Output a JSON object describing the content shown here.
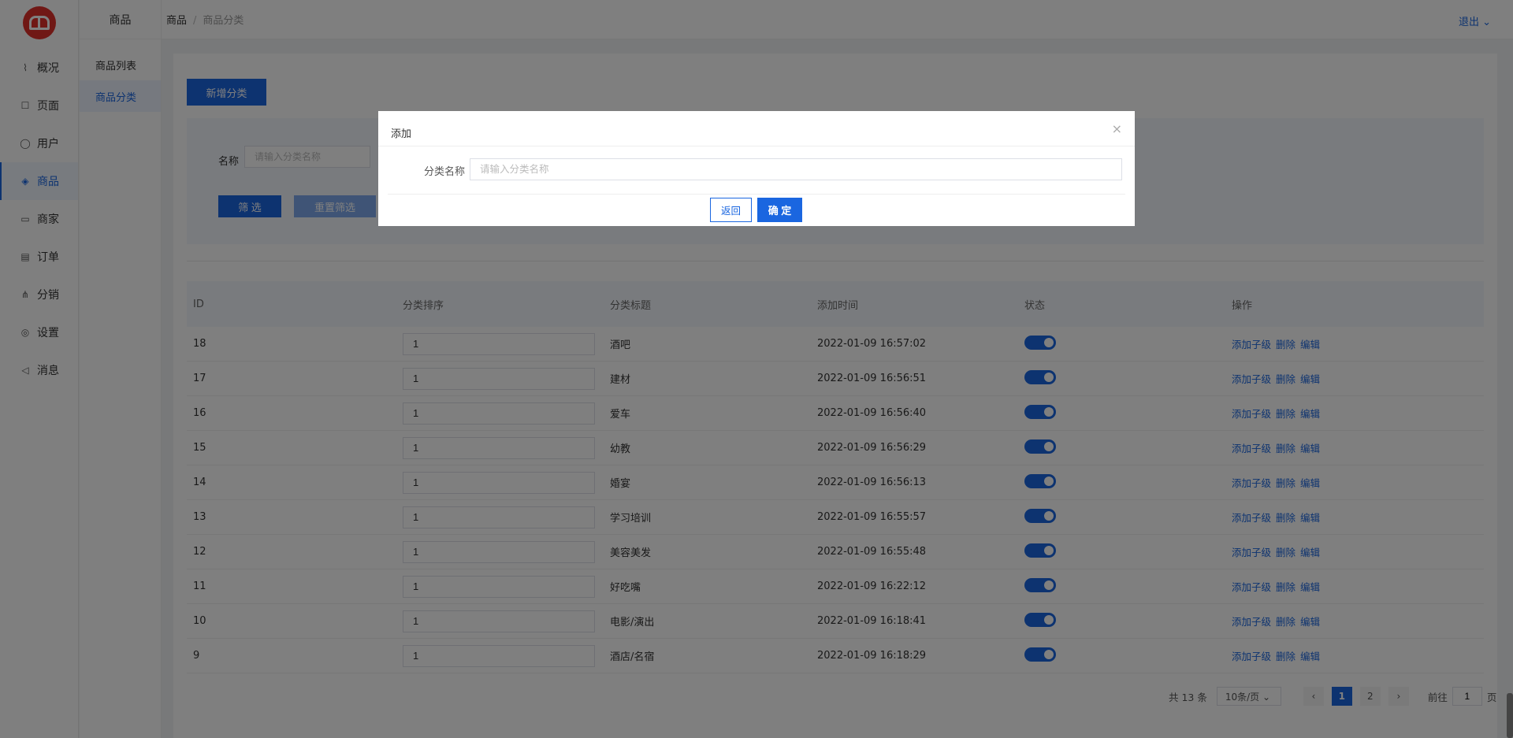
{
  "sidebar": {
    "items": [
      {
        "label": "概况",
        "icon": "chart-icon"
      },
      {
        "label": "页面",
        "icon": "page-icon"
      },
      {
        "label": "用户",
        "icon": "user-icon"
      },
      {
        "label": "商品",
        "icon": "cube-icon"
      },
      {
        "label": "商家",
        "icon": "store-icon"
      },
      {
        "label": "订单",
        "icon": "order-icon"
      },
      {
        "label": "分销",
        "icon": "distribution-icon"
      },
      {
        "label": "设置",
        "icon": "settings-icon"
      },
      {
        "label": "消息",
        "icon": "message-icon"
      }
    ],
    "active_index": 3
  },
  "subbar": {
    "title": "商品",
    "items": [
      "商品列表",
      "商品分类"
    ],
    "active_index": 1
  },
  "header": {
    "crumb_root": "商品",
    "crumb_sep": "/",
    "crumb_current": "商品分类",
    "logout": "退出 ⌄"
  },
  "toolbar": {
    "add_label": "新增分类"
  },
  "filter": {
    "name_label": "名称",
    "name_placeholder": "请输入分类名称",
    "filter_label": "筛 选",
    "reset_label": "重置筛选"
  },
  "table": {
    "headers": [
      "ID",
      "分类排序",
      "分类标题",
      "添加时间",
      "状态",
      "操作"
    ],
    "rows": [
      {
        "id": "18",
        "sort": "1",
        "title": "酒吧",
        "time": "2022-01-09 16:57:02"
      },
      {
        "id": "17",
        "sort": "1",
        "title": "建材",
        "time": "2022-01-09 16:56:51"
      },
      {
        "id": "16",
        "sort": "1",
        "title": "爱车",
        "time": "2022-01-09 16:56:40"
      },
      {
        "id": "15",
        "sort": "1",
        "title": "幼教",
        "time": "2022-01-09 16:56:29"
      },
      {
        "id": "14",
        "sort": "1",
        "title": "婚宴",
        "time": "2022-01-09 16:56:13"
      },
      {
        "id": "13",
        "sort": "1",
        "title": "学习培训",
        "time": "2022-01-09 16:55:57"
      },
      {
        "id": "12",
        "sort": "1",
        "title": "美容美发",
        "time": "2022-01-09 16:55:48"
      },
      {
        "id": "11",
        "sort": "1",
        "title": "好吃嘴",
        "time": "2022-01-09 16:22:12"
      },
      {
        "id": "10",
        "sort": "1",
        "title": "电影/演出",
        "time": "2022-01-09 16:18:41"
      },
      {
        "id": "9",
        "sort": "1",
        "title": "酒店/名宿",
        "time": "2022-01-09 16:18:29"
      }
    ],
    "ops": [
      "添加子级",
      "删除",
      "编辑"
    ]
  },
  "pager": {
    "total": "共 13 条",
    "size": "10条/页 ⌄",
    "prev": "‹",
    "pages": [
      "1",
      "2"
    ],
    "next": "›",
    "goto_prefix": "前往",
    "goto_value": "1",
    "goto_suffix": "页"
  },
  "dialog": {
    "title": "添加",
    "close": "×",
    "field_label": "分类名称",
    "field_placeholder": "请输入分类名称",
    "back_label": "返回",
    "ok_label": "确 定"
  }
}
